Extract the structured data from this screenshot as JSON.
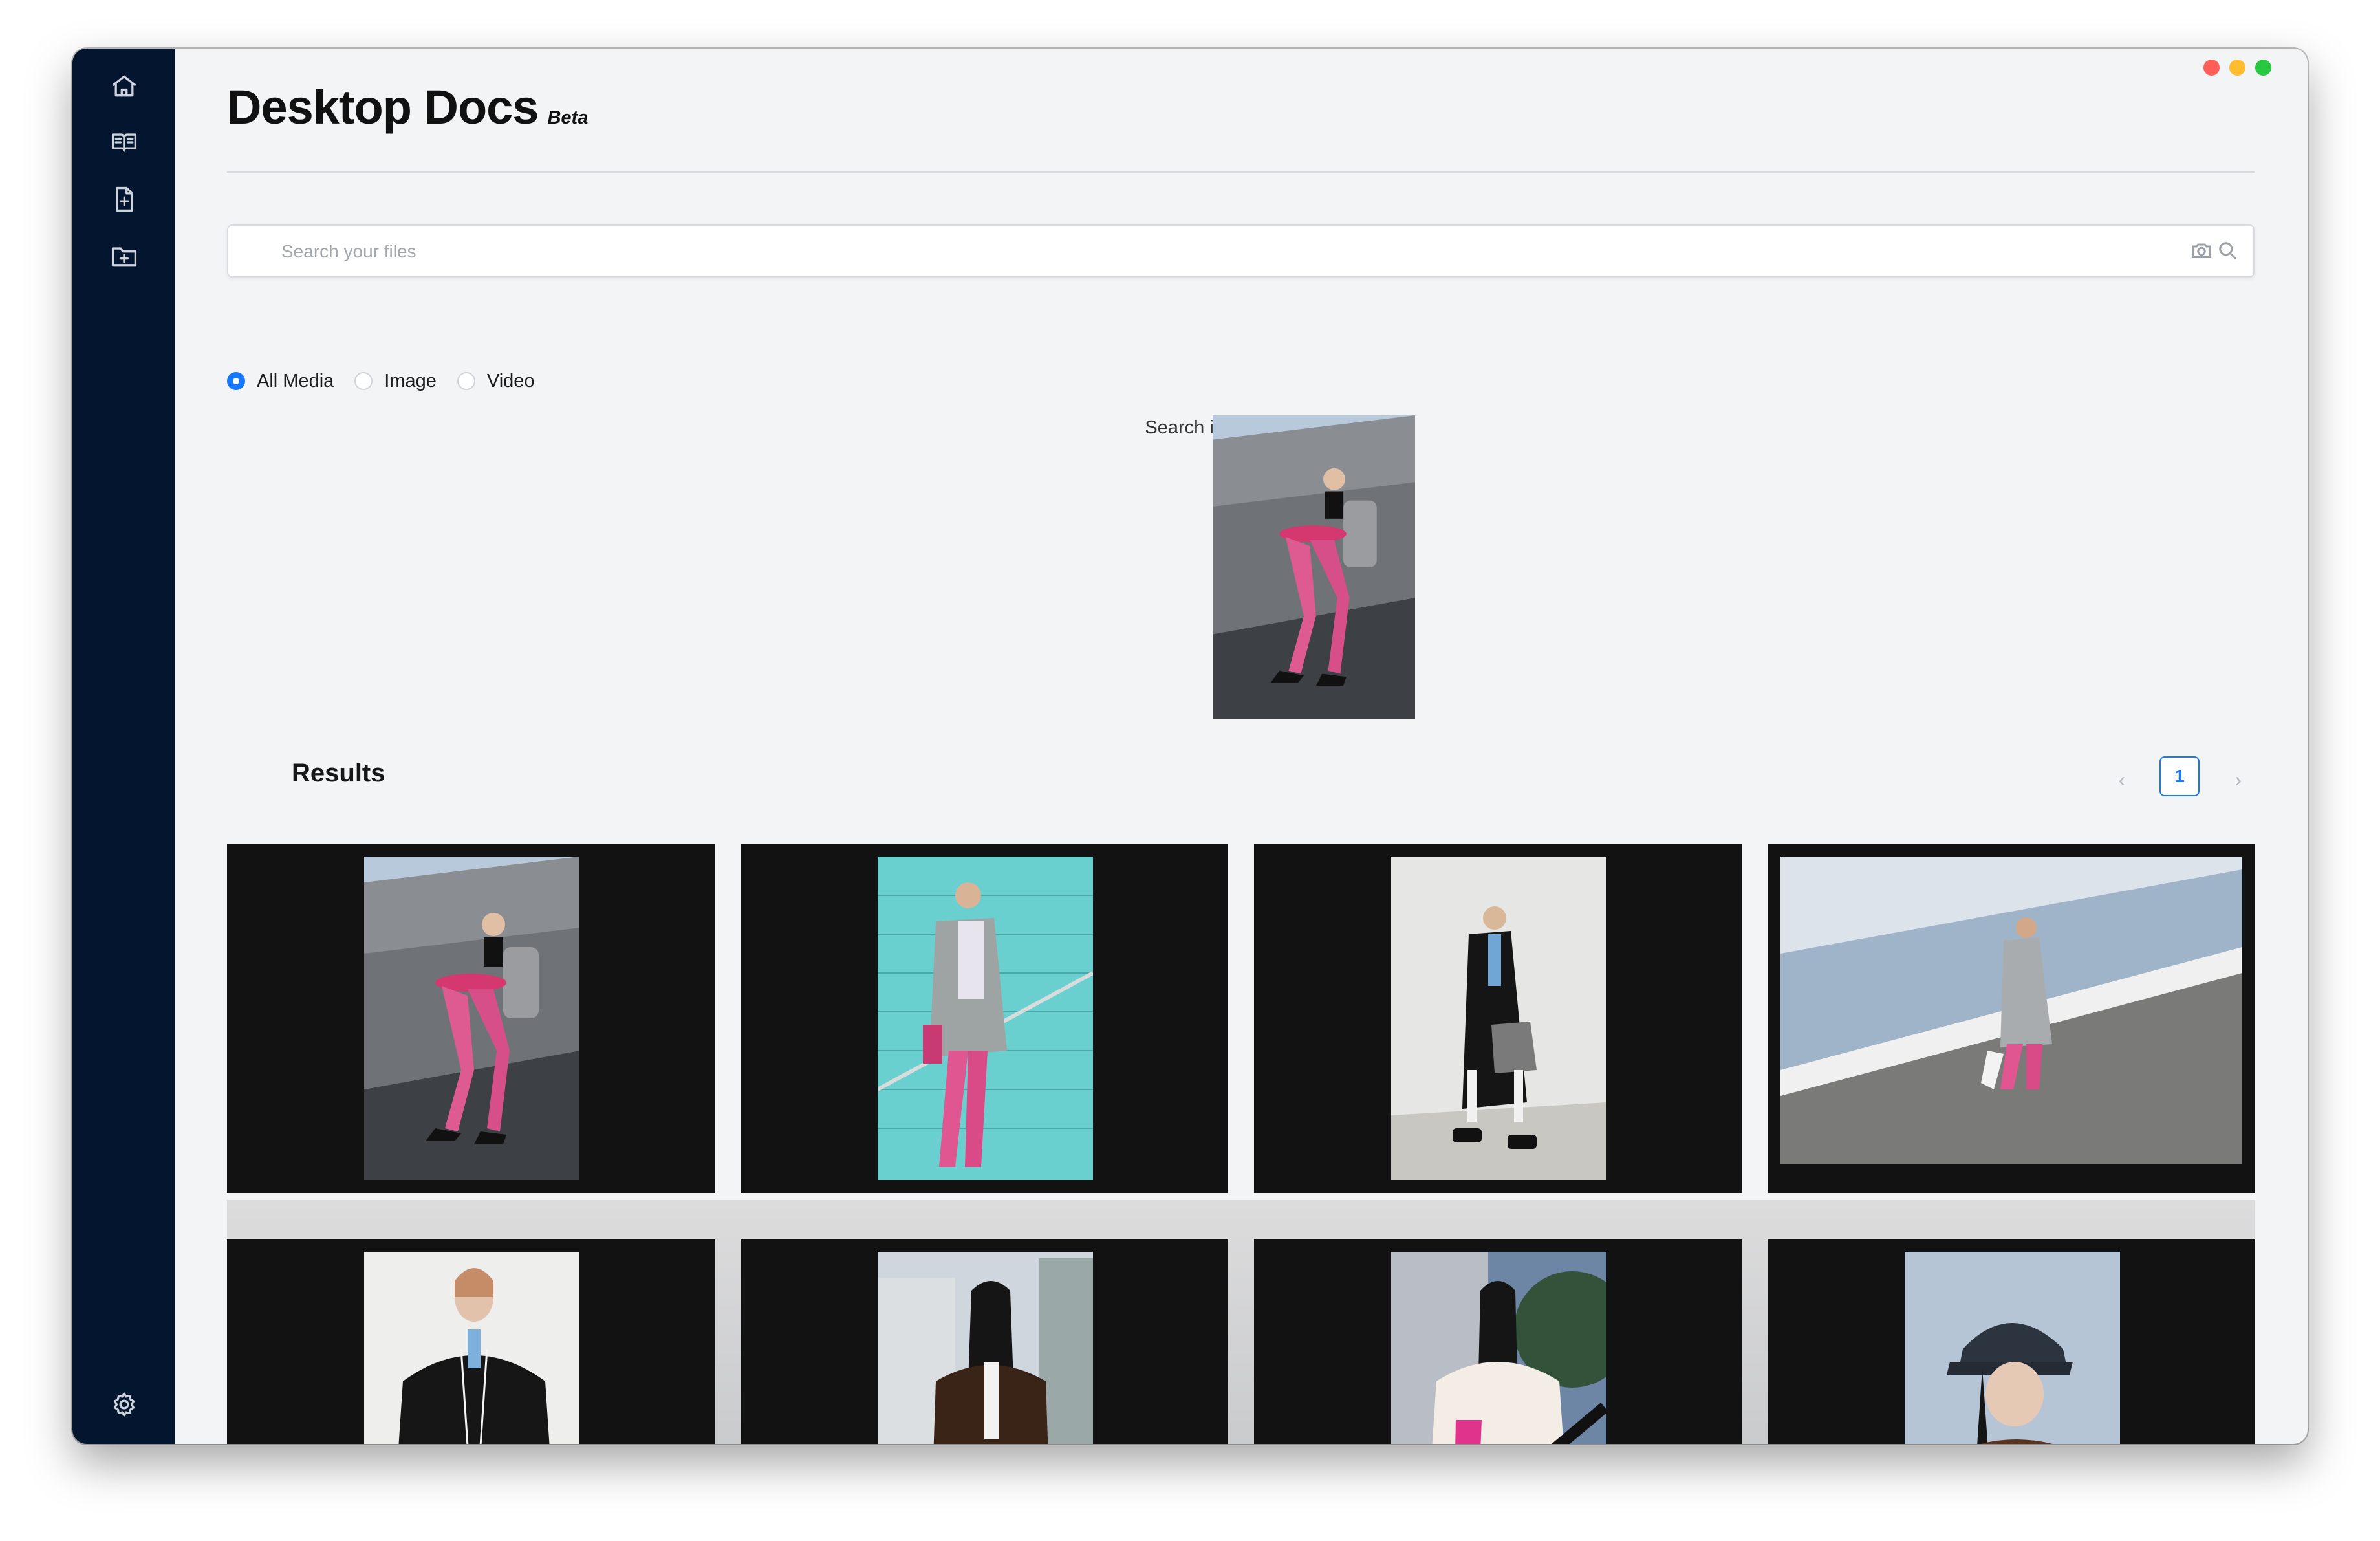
{
  "app": {
    "title": "Desktop Docs",
    "badge": "Beta"
  },
  "window_controls": {
    "close_color": "#ff5f57",
    "minimize_color": "#febc2e",
    "zoom_color": "#28c840"
  },
  "sidebar": {
    "items": [
      {
        "icon": "home-icon"
      },
      {
        "icon": "book-icon"
      },
      {
        "icon": "add-file-icon"
      },
      {
        "icon": "add-folder-icon"
      }
    ],
    "bottom": {
      "icon": "gear-icon"
    }
  },
  "search": {
    "placeholder": "Search your files",
    "value": "",
    "icons": [
      "camera-icon",
      "search-icon"
    ]
  },
  "filters": {
    "options": [
      "All Media",
      "Image",
      "Video"
    ],
    "selected": "All Media"
  },
  "similar": {
    "label": "Search images like this"
  },
  "results": {
    "title": "Results",
    "pagination": {
      "current_page": "1"
    },
    "items": [
      {
        "kind": "image",
        "description": "woman in grey blazer and pink tights sitting on concrete ledge"
      },
      {
        "kind": "image",
        "description": "woman with headphones walking past turquoise tiled wall"
      },
      {
        "kind": "image",
        "description": "woman in long black coat walking by white wall"
      },
      {
        "kind": "image",
        "description": "woman in grey coat walking along slanted wall"
      },
      {
        "kind": "image",
        "description": "woman in black coat with earphones against white wall"
      },
      {
        "kind": "image",
        "description": "woman in brown leather jacket on city street"
      },
      {
        "kind": "image",
        "description": "woman in white fur coat with pink accents"
      },
      {
        "kind": "image",
        "description": "woman in navy cap and brown leather jacket"
      }
    ]
  },
  "colors": {
    "sidebar": "#03152f",
    "background": "#f3f4f6",
    "accent": "#1677ff",
    "card": "#121212"
  }
}
